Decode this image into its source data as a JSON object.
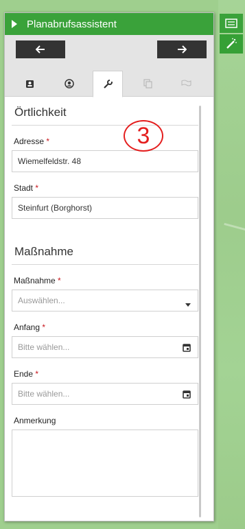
{
  "panel": {
    "title": "Planabrufsassistent",
    "step_number": "3"
  },
  "location": {
    "section_title": "Örtlichkeit",
    "address_label": "Adresse",
    "address_value": "Wiemelfeldstr. 48",
    "city_label": "Stadt",
    "city_value": "Steinfurt (Borghorst)",
    "required_marker": "*"
  },
  "measure": {
    "section_title": "Maßnahme",
    "measure_label": "Maßnahme",
    "measure_placeholder": "Auswählen...",
    "start_label": "Anfang",
    "start_placeholder": "Bitte wählen...",
    "end_label": "Ende",
    "end_placeholder": "Bitte wählen...",
    "remark_label": "Anmerkung",
    "required_marker": "*"
  },
  "tabs": [
    {
      "icon": "contact-card-icon",
      "active": false
    },
    {
      "icon": "user-circle-icon",
      "active": false
    },
    {
      "icon": "wrench-icon",
      "active": true
    },
    {
      "icon": "copy-icon",
      "active": false
    },
    {
      "icon": "flag-icon",
      "active": false
    }
  ],
  "colors": {
    "header_green": "#3aa23a",
    "required_red": "#c8151b",
    "badge_red": "#e41e1e"
  }
}
